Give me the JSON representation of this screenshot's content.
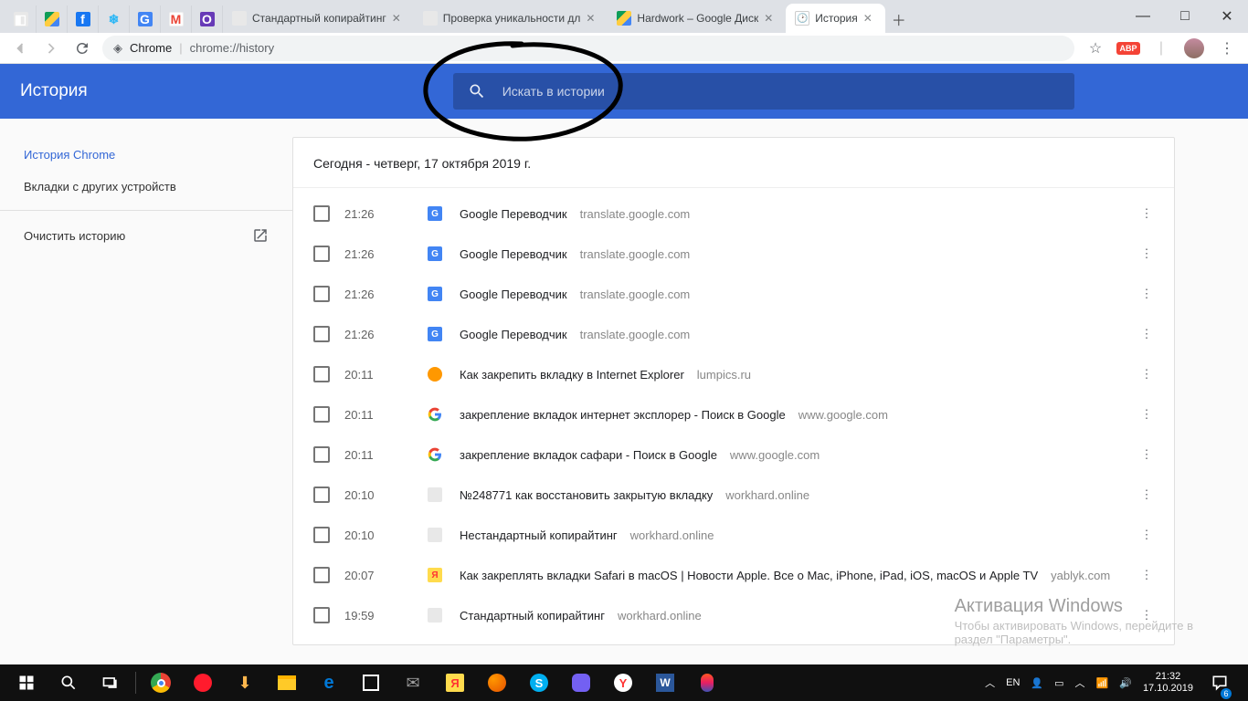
{
  "window_controls": {
    "min": "—",
    "max": "□",
    "close": "✕"
  },
  "tabs_pinned": [
    {
      "cls": "fi-wh",
      "txt": "◧"
    },
    {
      "cls": "fi-gdrive",
      "txt": ""
    },
    {
      "cls": "fi-fb",
      "txt": "f"
    },
    {
      "cls": "",
      "txt": "❄",
      "style": "color:#29b6f6"
    },
    {
      "cls": "fi-gtrans",
      "txt": "G"
    },
    {
      "cls": "fi-gmail",
      "txt": "M"
    },
    {
      "cls": "fi-purple",
      "txt": "O"
    }
  ],
  "tabs": [
    {
      "fav": "fi-wh",
      "title": "Стандартный копирайтинг",
      "active": false,
      "close": true
    },
    {
      "fav": "fi-wh",
      "title": "Проверка уникальности дл",
      "active": false,
      "close": true
    },
    {
      "fav": "fi-gdrive",
      "title": "Hardwork – Google Диск",
      "active": false,
      "close": true
    },
    {
      "fav": "fi-clock",
      "title": "История",
      "active": true,
      "close": true
    }
  ],
  "addr": {
    "host": "Chrome",
    "path": "chrome://history"
  },
  "ext_badge": "ABP",
  "history_header": "История",
  "search_placeholder": "Искать в истории",
  "sidebar": {
    "items": [
      {
        "label": "История Chrome",
        "sel": true
      },
      {
        "label": "Вкладки с других устройств",
        "sel": false
      }
    ],
    "clear": "Очистить историю"
  },
  "date_heading": "Сегодня - четверг, 17 октября 2019 г.",
  "entries": [
    {
      "time": "21:26",
      "fav": "fi-gtrans",
      "favtxt": "G",
      "title": "Google Переводчик",
      "url": "translate.google.com"
    },
    {
      "time": "21:26",
      "fav": "fi-gtrans",
      "favtxt": "G",
      "title": "Google Переводчик",
      "url": "translate.google.com"
    },
    {
      "time": "21:26",
      "fav": "fi-gtrans",
      "favtxt": "G",
      "title": "Google Переводчик",
      "url": "translate.google.com"
    },
    {
      "time": "21:26",
      "fav": "fi-gtrans",
      "favtxt": "G",
      "title": "Google Переводчик",
      "url": "translate.google.com"
    },
    {
      "time": "20:11",
      "fav": "fi-orange",
      "favtxt": "",
      "title": "Как закрепить вкладку в Internet Explorer",
      "url": "lumpics.ru"
    },
    {
      "time": "20:11",
      "fav": "glogo",
      "favtxt": "",
      "title": "закрепление вкладок интернет эксплорер - Поиск в Google",
      "url": "www.google.com"
    },
    {
      "time": "20:11",
      "fav": "glogo",
      "favtxt": "",
      "title": "закрепление вкладок сафари - Поиск в Google",
      "url": "www.google.com"
    },
    {
      "time": "20:10",
      "fav": "fi-wh",
      "favtxt": "",
      "title": "№248771 как восстановить закрытую вкладку",
      "url": "workhard.online"
    },
    {
      "time": "20:10",
      "fav": "fi-wh",
      "favtxt": "",
      "title": "Нестандартный копирайтинг",
      "url": "workhard.online"
    },
    {
      "time": "20:07",
      "fav": "fi-ya",
      "favtxt": "Я",
      "title": "Как закреплять вкладки Safari в macOS | Новости Apple. Все о Mac, iPhone, iPad, iOS, macOS и Apple TV",
      "url": "yablyk.com"
    },
    {
      "time": "19:59",
      "fav": "fi-wh",
      "favtxt": "",
      "title": "Стандартный копирайтинг",
      "url": "workhard.online"
    }
  ],
  "watermark": {
    "l1": "Активация Windows",
    "l2": "Чтобы активировать Windows, перейдите в",
    "l3": "раздел \"Параметры\"."
  },
  "taskbar": {
    "lang": "EN",
    "time": "21:32",
    "date": "17.10.2019"
  }
}
